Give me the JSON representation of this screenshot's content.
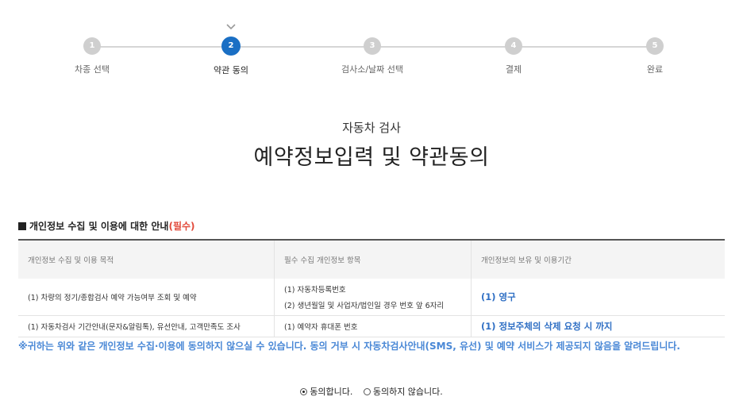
{
  "steps": [
    {
      "num": "1",
      "label": "차종 선택"
    },
    {
      "num": "2",
      "label": "약관 동의"
    },
    {
      "num": "3",
      "label": "검사소/날짜 선택"
    },
    {
      "num": "4",
      "label": "결제"
    },
    {
      "num": "5",
      "label": "완료"
    }
  ],
  "active_step": 2,
  "header": {
    "subtitle": "자동차 검사",
    "title": "예약정보입력 및 약관동의"
  },
  "privacy": {
    "heading": "개인정보 수집 및 이용에 대한 안내",
    "required_mark": "(필수)",
    "columns": [
      "개인정보 수집 및 이용 목적",
      "필수 수집 개인정보 항목",
      "개인정보의 보유 및 이용기간"
    ],
    "rows": [
      {
        "purpose": "(1) 차량의 정기/종합검사 예약 가능여부 조회 및 예약",
        "items": [
          "(1) 자동차등록번호",
          "(2) 생년월일 및 사업자/법인일 경우 번호 앞 6자리"
        ],
        "period": "(1) 영구"
      },
      {
        "purpose": "(1) 자동차검사 기간안내(문자&알림톡), 유선안내, 고객만족도 조사",
        "items": [
          "(1) 예약자 휴대폰 번호"
        ],
        "period": "(1) 정보주체의 삭제 요청 시 까지"
      }
    ],
    "notice": "※귀하는 위와 같은 개인정보 수집·이용에 동의하지 않으실 수 있습니다. 동의 거부 시 자동차검사안내(SMS, 유선) 및 예약 서비스가 제공되지 않음을 알려드립니다."
  },
  "consent": {
    "agree_label": "동의합니다.",
    "disagree_label": "동의하지 않습니다.",
    "selected": "agree"
  },
  "colors": {
    "active_step": "#1a6fc4",
    "inactive_step": "#cfcfcf",
    "required": "#e24a3b",
    "notice": "#4a88d6",
    "period": "#2f6fc4"
  }
}
